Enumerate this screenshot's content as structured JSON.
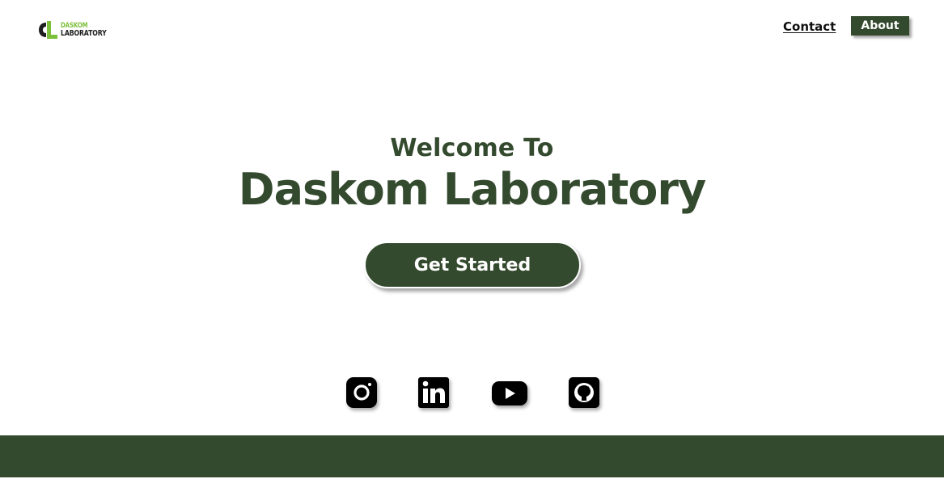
{
  "brand": {
    "logo_line1": "DASKOM",
    "logo_line2": "LABORATORY"
  },
  "nav": {
    "contact_label": "Contact",
    "about_label": "About"
  },
  "hero": {
    "welcome": "Welcome To",
    "title": "Daskom Laboratory",
    "cta_label": "Get Started"
  },
  "social": [
    {
      "icon": "instagram-icon"
    },
    {
      "icon": "linkedin-icon"
    },
    {
      "icon": "youtube-icon"
    },
    {
      "icon": "github-icon"
    }
  ],
  "colors": {
    "primary": "#344a2e",
    "logo_green": "#7cbf3a",
    "background": "#ffffff",
    "text_dark": "#111111"
  }
}
